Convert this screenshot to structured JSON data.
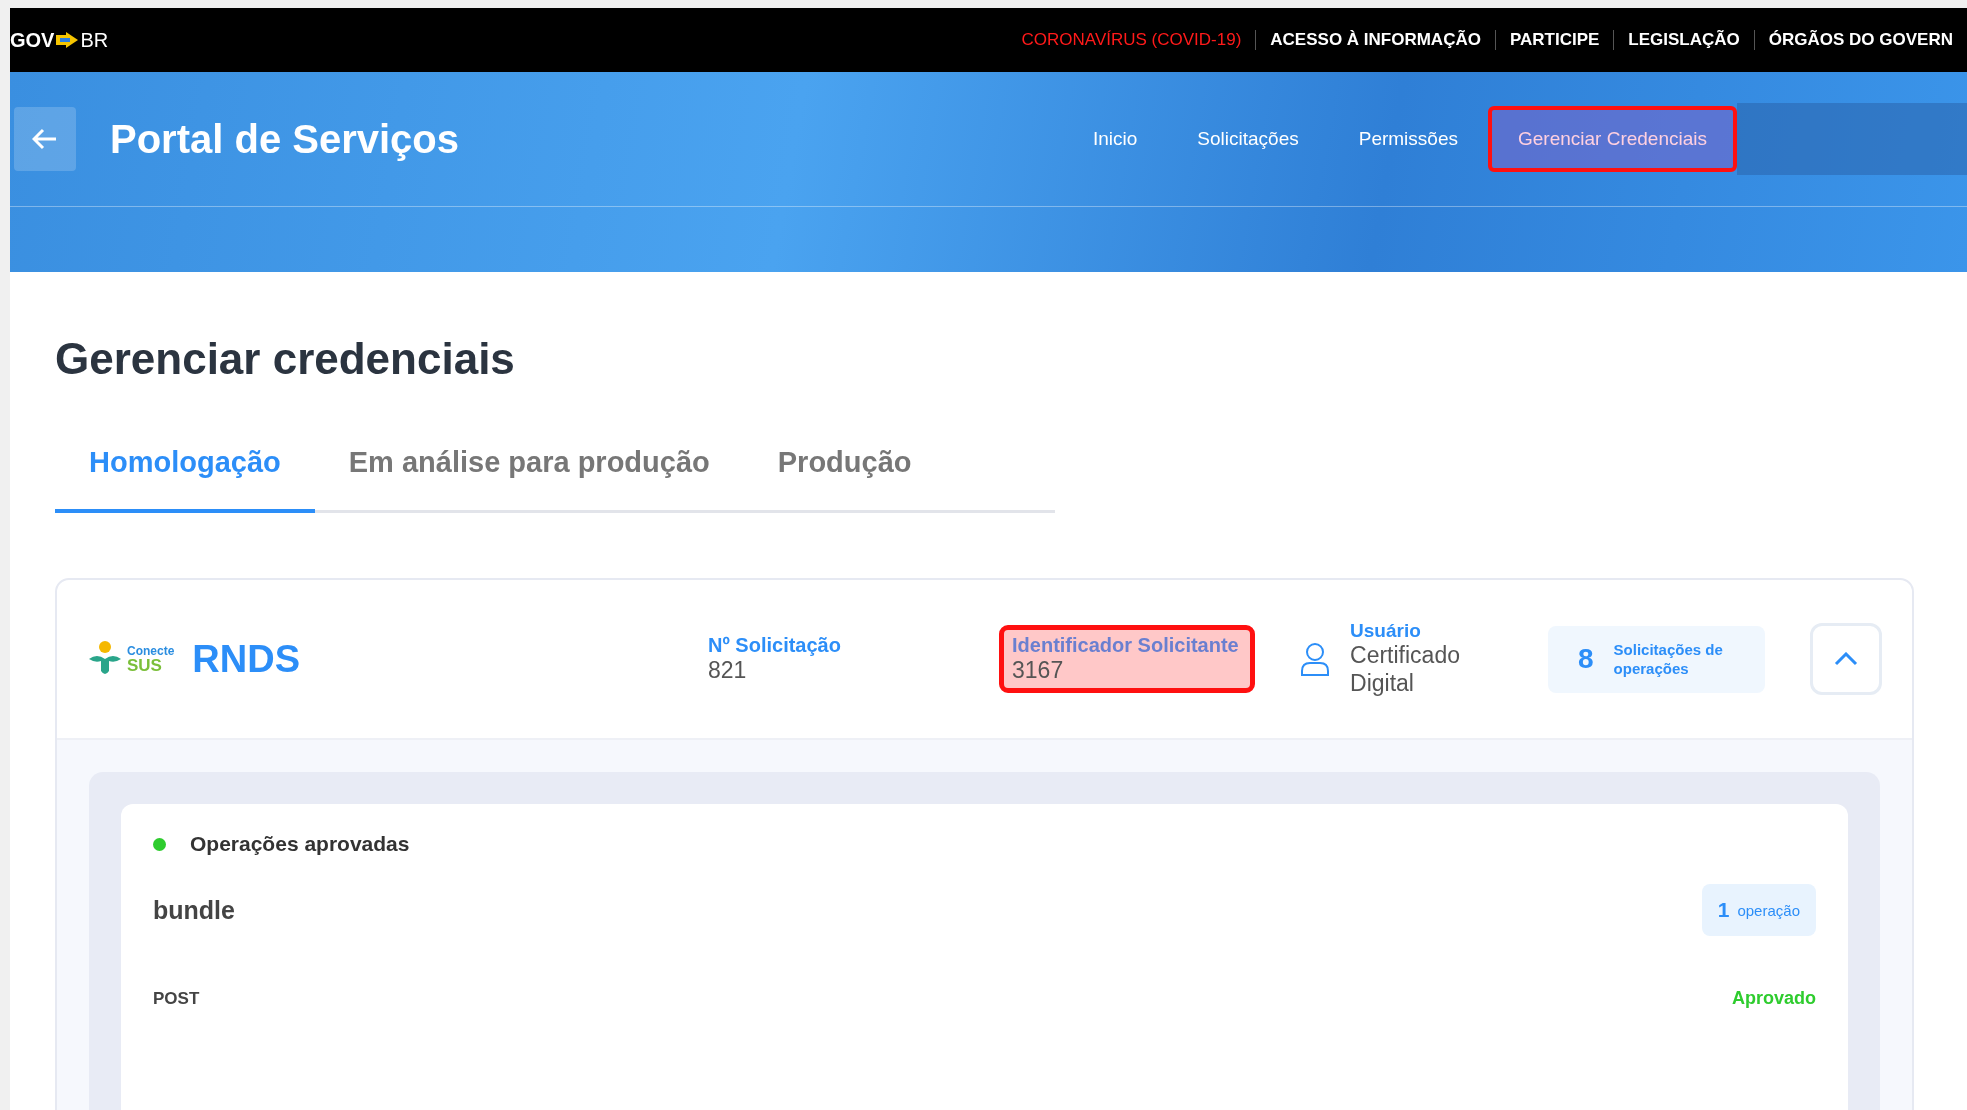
{
  "gov_bar": {
    "logo": "GOV",
    "logo_suffix": "BR",
    "links": [
      {
        "label": "CORONAVÍRUS (COVID-19)",
        "kind": "alert"
      },
      {
        "label": "ACESSO À INFORMAÇÃO",
        "kind": "normal"
      },
      {
        "label": "PARTICIPE",
        "kind": "normal"
      },
      {
        "label": "LEGISLAÇÃO",
        "kind": "normal"
      },
      {
        "label": "ÓRGÃOS DO GOVERN",
        "kind": "normal"
      }
    ]
  },
  "header": {
    "title": "Portal de Serviços",
    "nav": [
      {
        "label": "Inicio",
        "selected": false,
        "highlighted": false
      },
      {
        "label": "Solicitações",
        "selected": false,
        "highlighted": false
      },
      {
        "label": "Permissões",
        "selected": false,
        "highlighted": false
      },
      {
        "label": "Gerenciar Credenciais",
        "selected": true,
        "highlighted": true
      }
    ]
  },
  "page_title": "Gerenciar credenciais",
  "tabs": [
    {
      "label": "Homologação",
      "selected": true
    },
    {
      "label": "Em análise para produção",
      "selected": false
    },
    {
      "label": "Produção",
      "selected": false
    }
  ],
  "credential": {
    "logo_top": "Conecte",
    "logo_bottom": "SUS",
    "name": "RNDS",
    "fields": [
      {
        "label": "Nº Solicitação",
        "value": "821",
        "highlighted": false
      },
      {
        "label": "Identificador Solicitante",
        "value": "3167",
        "highlighted": true
      }
    ],
    "user": {
      "label": "Usuário",
      "value": "Certificado Digital"
    },
    "requests": {
      "count": "8",
      "label": "Solicitações de operações"
    },
    "expanded": true,
    "groups": [
      {
        "title": "Operações aprovadas",
        "color": "#2ecc2e",
        "bundles": [
          {
            "name": "bundle",
            "count": "1",
            "count_label": "operação",
            "operations": [
              {
                "method": "POST",
                "status": "Aprovado"
              }
            ]
          }
        ]
      }
    ]
  }
}
